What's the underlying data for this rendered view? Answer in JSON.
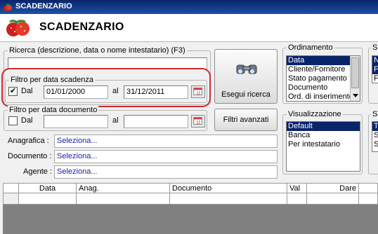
{
  "window": {
    "title": "SCADENZARIO"
  },
  "header": {
    "title": "SCADENZARIO"
  },
  "search": {
    "legend": "Ricerca (descrizione, data o nome intestatario) (F3)",
    "value": ""
  },
  "filter_due": {
    "legend": "Filtro per data scadenza",
    "checked": "✔",
    "from_label": "Dal",
    "from_value": "01/01/2000",
    "to_label": "al",
    "to_value": "31/12/2011"
  },
  "filter_doc": {
    "legend": "Filtro per data documento",
    "from_label": "Dal",
    "from_value": "",
    "to_label": "al",
    "to_value": ""
  },
  "buttons": {
    "search": "Esegui ricerca",
    "advanced": "Filtri avanzati"
  },
  "ordering": {
    "legend": "Ordinamento",
    "items": [
      "Data",
      "Cliente/Fornitore",
      "Stato pagamento",
      "Documento",
      "Ord. di inserimento"
    ]
  },
  "view": {
    "legend": "Visualizzazione",
    "items": [
      "Default",
      "Banca",
      "Per intestatario"
    ]
  },
  "right_group_1": {
    "legend": "S",
    "items": [
      "N",
      "F",
      "F"
    ]
  },
  "right_group_2": {
    "legend": "S",
    "items": [
      "T",
      "S",
      "S"
    ]
  },
  "fields": {
    "anagrafica_label": "Anagrafica :",
    "anagrafica_value": "Seleziona...",
    "documento_label": "Documento :",
    "documento_value": "Seleziona...",
    "agente_label": "Agente :",
    "agente_value": "Seleziona..."
  },
  "grid": {
    "columns": [
      "Data",
      "Anag.",
      "Documento",
      "Val",
      "Dare"
    ]
  },
  "colors": {
    "titlebar": "#0a246a",
    "selection": "#0a246a",
    "highlight": "#d42a2a",
    "link_text": "#1a1ab0"
  }
}
